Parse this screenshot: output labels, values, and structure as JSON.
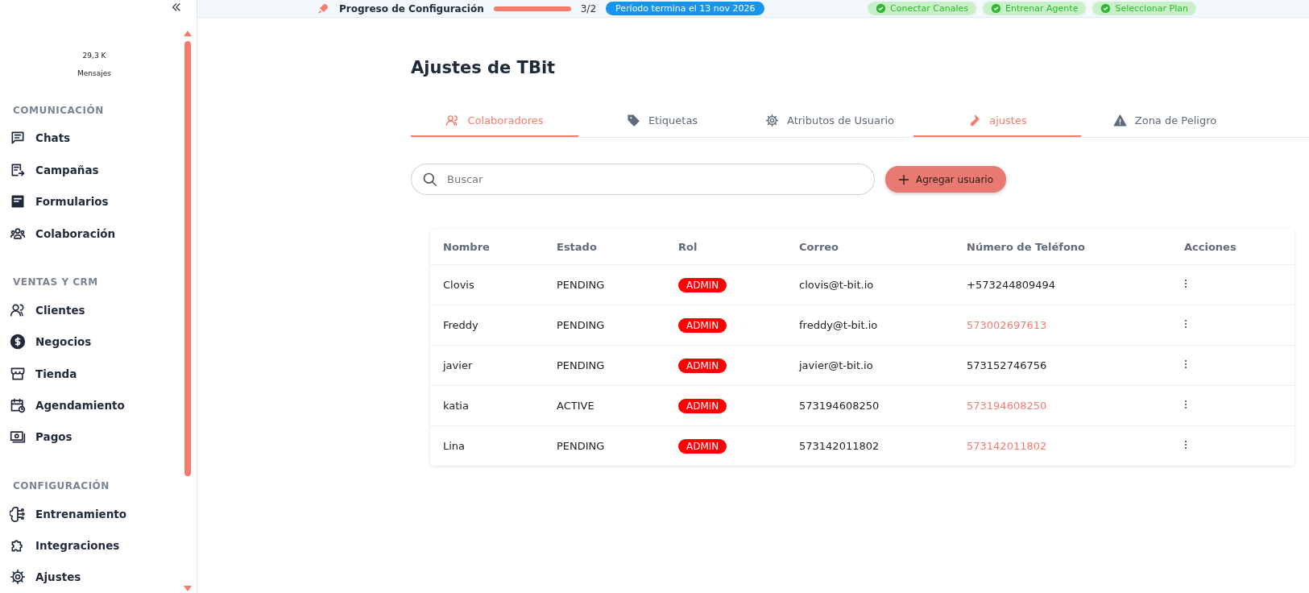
{
  "topbar": {
    "progress_label": "Progreso de Configuración",
    "progress": {
      "level": 1
    },
    "progress_count": "3/2",
    "period_badge": "Período termina el 13 nov 2026",
    "steps": [
      {
        "label": "Conectar Canales",
        "done": true
      },
      {
        "label": "Entrenar Agente",
        "done": true
      },
      {
        "label": "Seleccionar Plan",
        "done": true
      }
    ]
  },
  "sidebar": {
    "stat_value": "29,3 K",
    "stat_label": "Mensajes",
    "sections": [
      {
        "title": "COMUNICACIÓN",
        "items": [
          {
            "label": "Chats"
          },
          {
            "label": "Campañas"
          },
          {
            "label": "Formularios"
          },
          {
            "label": "Colaboración"
          }
        ]
      },
      {
        "title": "VENTAS Y CRM",
        "items": [
          {
            "label": "Clientes"
          },
          {
            "label": "Negocios"
          },
          {
            "label": "Tienda"
          },
          {
            "label": "Agendamiento"
          },
          {
            "label": "Pagos"
          }
        ]
      },
      {
        "title": "CONFIGURACIÓN",
        "items": [
          {
            "label": "Entrenamiento"
          },
          {
            "label": "Integraciones"
          },
          {
            "label": "Ajustes"
          }
        ]
      }
    ]
  },
  "page": {
    "title": "Ajustes de TBit",
    "tabs": [
      {
        "label": "Colaboradores",
        "selected": true
      },
      {
        "label": "Etiquetas",
        "selected": false
      },
      {
        "label": "Atributos de Usuario",
        "selected": false
      },
      {
        "label": "ajustes",
        "selected": true
      },
      {
        "label": "Zona de Peligro",
        "selected": false
      }
    ],
    "search": {
      "placeholder": "Buscar"
    },
    "add_button": "Agregar usuario"
  },
  "table": {
    "columns": [
      "Nombre",
      "Estado",
      "Rol",
      "Correo",
      "Número de Teléfono",
      "Acciones"
    ],
    "rows": [
      {
        "name": "Clovis",
        "status": "PENDING",
        "role": "ADMIN",
        "email": "clovis@t-bit.io",
        "phone": "+573244809494",
        "phone_highlighted": false
      },
      {
        "name": "Freddy",
        "status": "PENDING",
        "role": "ADMIN",
        "email": "freddy@t-bit.io",
        "phone": "573002697613",
        "phone_highlighted": true
      },
      {
        "name": "javier",
        "status": "PENDING",
        "role": "ADMIN",
        "email": "javier@t-bit.io",
        "phone": "573152746756",
        "phone_highlighted": false
      },
      {
        "name": "katia",
        "status": "ACTIVE",
        "role": "ADMIN",
        "email": "573194608250",
        "phone": "573194608250",
        "phone_highlighted": true
      },
      {
        "name": "Lina",
        "status": "PENDING",
        "role": "ADMIN",
        "email": "573142011802",
        "phone": "573142011802",
        "phone_highlighted": true
      }
    ]
  }
}
